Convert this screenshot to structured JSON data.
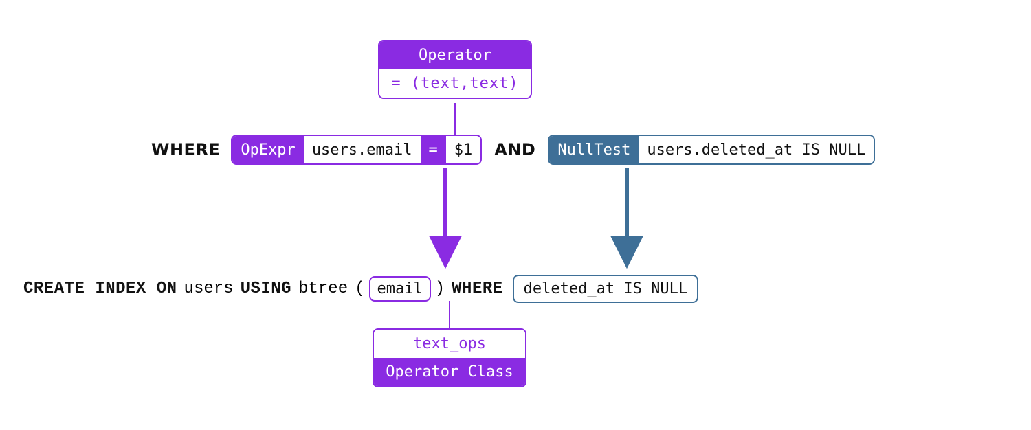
{
  "operator_box": {
    "title": "Operator",
    "signature": "= (text,text)"
  },
  "where_row": {
    "kw_where": "WHERE",
    "opexpr_tag": "OpExpr",
    "opexpr_left": "users.email",
    "opexpr_eq": "=",
    "opexpr_right": "$1",
    "kw_and": "AND",
    "nulltest_tag": "NullTest",
    "nulltest_body": "users.deleted_at IS NULL"
  },
  "create_row": {
    "kw_create_index_on": "CREATE INDEX ON",
    "table": "users",
    "kw_using": "USING",
    "method": "btree",
    "paren_open": "(",
    "column": "email",
    "paren_close": ")",
    "kw_where": "WHERE",
    "predicate": "deleted_at IS NULL"
  },
  "opclass_box": {
    "name": "text_ops",
    "label": "Operator Class"
  },
  "colors": {
    "purple": "#8A2BE2",
    "blue": "#3E6F97"
  }
}
